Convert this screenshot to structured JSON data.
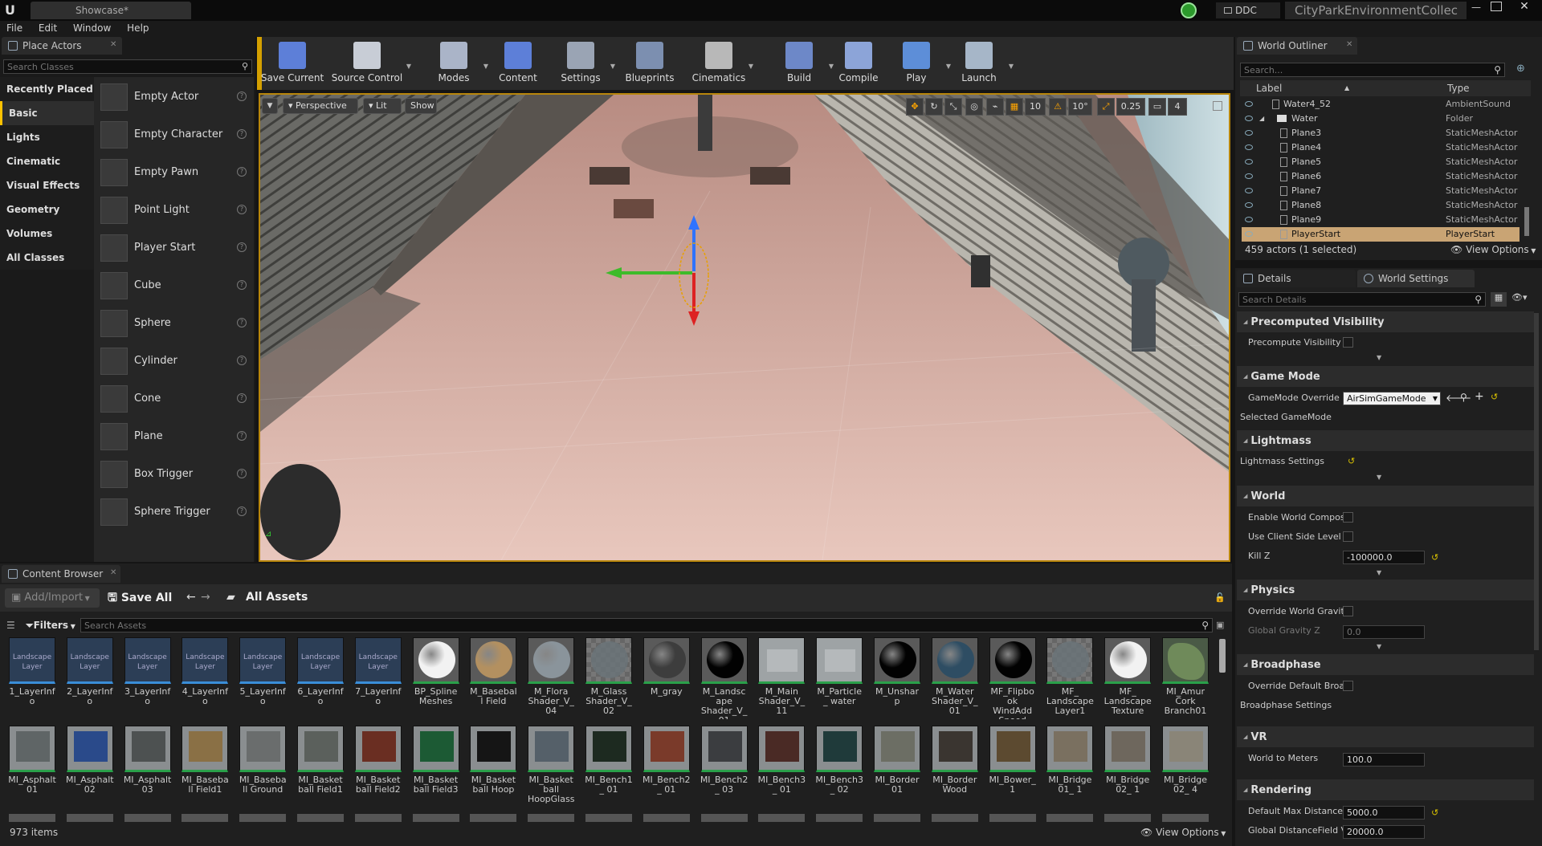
{
  "titlebar": {
    "tab": "Showcase*",
    "ddc": "DDC",
    "project": "CityParkEnvironmentCollec"
  },
  "menu": [
    "File",
    "Edit",
    "Window",
    "Help"
  ],
  "place_actors": {
    "tab": "Place Actors",
    "search_placeholder": "Search Classes",
    "categories": [
      "Recently Placed",
      "Basic",
      "Lights",
      "Cinematic",
      "Visual Effects",
      "Geometry",
      "Volumes",
      "All Classes"
    ],
    "active_category": "Basic",
    "actors": [
      "Empty Actor",
      "Empty Character",
      "Empty Pawn",
      "Point Light",
      "Player Start",
      "Cube",
      "Sphere",
      "Cylinder",
      "Cone",
      "Plane",
      "Box Trigger",
      "Sphere Trigger"
    ]
  },
  "toolbar": [
    {
      "label": "Save Current",
      "icon": "save-icon"
    },
    {
      "label": "Source Control",
      "icon": "source-control-icon"
    },
    {
      "label": "Modes",
      "icon": "modes-icon"
    },
    {
      "label": "Content",
      "icon": "content-icon"
    },
    {
      "label": "Settings",
      "icon": "settings-icon"
    },
    {
      "label": "Blueprints",
      "icon": "blueprints-icon"
    },
    {
      "label": "Cinematics",
      "icon": "cinematics-icon"
    },
    {
      "label": "Build",
      "icon": "build-icon"
    },
    {
      "label": "Compile",
      "icon": "compile-icon"
    },
    {
      "label": "Play",
      "icon": "play-icon"
    },
    {
      "label": "Launch",
      "icon": "launch-icon"
    }
  ],
  "viewport": {
    "perspective": "Perspective",
    "lit": "Lit",
    "show": "Show",
    "grid_snap": "10",
    "rotation_snap": "10°",
    "scale_snap": "0.25",
    "camera_speed": "4"
  },
  "outliner": {
    "tab": "World Outliner",
    "search_placeholder": "Search...",
    "col_label": "Label",
    "col_type": "Type",
    "rows": [
      {
        "name": "Water4_52",
        "type": "AmbientSound"
      },
      {
        "name": "Water",
        "type": "Folder"
      },
      {
        "name": "Plane3",
        "type": "StaticMeshActor"
      },
      {
        "name": "Plane4",
        "type": "StaticMeshActor"
      },
      {
        "name": "Plane5",
        "type": "StaticMeshActor"
      },
      {
        "name": "Plane6",
        "type": "StaticMeshActor"
      },
      {
        "name": "Plane7",
        "type": "StaticMeshActor"
      },
      {
        "name": "Plane8",
        "type": "StaticMeshActor"
      },
      {
        "name": "Plane9",
        "type": "StaticMeshActor"
      },
      {
        "name": "PlayerStart",
        "type": "PlayerStart"
      }
    ],
    "status": "459 actors (1 selected)",
    "view_options": "View Options"
  },
  "details": {
    "tab_details": "Details",
    "tab_world": "World Settings",
    "search_placeholder": "Search Details",
    "sections": {
      "precomputed": "Precomputed Visibility",
      "precompute_visibility": "Precompute Visibility",
      "game_mode": "Game Mode",
      "gamemode_override": "GameMode Override",
      "gamemode_value": "AirSimGameMode",
      "selected_gamemode": "Selected GameMode",
      "lightmass": "Lightmass",
      "lightmass_settings": "Lightmass Settings",
      "world": "World",
      "enable_world_compos": "Enable World Composi",
      "use_client_side": "Use Client Side Level S",
      "kill_z": "Kill Z",
      "kill_z_value": "-100000.0",
      "physics": "Physics",
      "override_gravity": "Override World Gravity",
      "global_gravity": "Global Gravity Z",
      "global_gravity_value": "0.0",
      "broadphase": "Broadphase",
      "override_broad": "Override Default Broac",
      "broadphase_settings": "Broadphase Settings",
      "vr": "VR",
      "world_to_meters": "World to Meters",
      "world_to_meters_value": "100.0",
      "rendering": "Rendering",
      "default_max_distance": "Default Max Distancel",
      "default_max_value": "5000.0",
      "global_distance_field": "Global DistanceField V",
      "global_distance_value": "20000.0"
    }
  },
  "content_browser": {
    "tab": "Content Browser",
    "add_import": "Add/Import",
    "save_all": "Save All",
    "path": "All Assets",
    "filters": "Filters",
    "search_placeholder": "Search Assets",
    "item_count": "973 items",
    "view_options": "View Options",
    "row1": [
      {
        "label": "1_LayerInfo",
        "thumb": "Landscape Layer",
        "kind": "layer"
      },
      {
        "label": "2_LayerInfo",
        "thumb": "Landscape Layer",
        "kind": "layer"
      },
      {
        "label": "3_LayerInfo",
        "thumb": "Landscape Layer",
        "kind": "layer"
      },
      {
        "label": "4_LayerInfo",
        "thumb": "Landscape Layer",
        "kind": "layer"
      },
      {
        "label": "5_LayerInfo",
        "thumb": "Landscape Layer",
        "kind": "layer"
      },
      {
        "label": "6_LayerInfo",
        "thumb": "Landscape Layer",
        "kind": "layer"
      },
      {
        "label": "7_LayerInfo",
        "thumb": "Landscape Layer",
        "kind": "layer"
      },
      {
        "label": "BP_Spline Meshes",
        "thumb": "",
        "kind": "white"
      },
      {
        "label": "M_Baseball Field",
        "thumb": "",
        "kind": "sand"
      },
      {
        "label": "M_Flora Shader_V_04",
        "thumb": "",
        "kind": "gray"
      },
      {
        "label": "M_Glass Shader_V_02",
        "thumb": "",
        "kind": "checker"
      },
      {
        "label": "M_gray",
        "thumb": "",
        "kind": "dark"
      },
      {
        "label": "M_Landscape Shader_V_01",
        "thumb": "",
        "kind": "black"
      },
      {
        "label": "M_Main Shader_V_11",
        "thumb": "",
        "kind": "flat"
      },
      {
        "label": "M_Particle_ water",
        "thumb": "",
        "kind": "flat"
      },
      {
        "label": "M_Unsharp",
        "thumb": "",
        "kind": "black"
      },
      {
        "label": "M_Water Shader_V_01",
        "thumb": "",
        "kind": "blue"
      },
      {
        "label": "MF_Flipbook WindAdd Speed",
        "thumb": "",
        "kind": "black"
      },
      {
        "label": "MF_ Landscape Layer1",
        "thumb": "",
        "kind": "checker"
      },
      {
        "label": "MF_ Landscape Texture",
        "thumb": "",
        "kind": "white"
      },
      {
        "label": "MI_Amur Cork Branch01",
        "thumb": "",
        "kind": "leaf"
      }
    ],
    "row2": [
      {
        "label": "MI_Asphalt01",
        "color": "#5f6566"
      },
      {
        "label": "MI_Asphalt02",
        "color": "#2a4a8a"
      },
      {
        "label": "MI_Asphalt03",
        "color": "#4d5151"
      },
      {
        "label": "MI_Baseball Field1",
        "color": "#8a7045"
      },
      {
        "label": "MI_Baseball Ground",
        "color": "#6a6d6d"
      },
      {
        "label": "MI_Basketball Field1",
        "color": "#5b605c"
      },
      {
        "label": "MI_Basketball Field2",
        "color": "#6a2e22"
      },
      {
        "label": "MI_Basketball Field3",
        "color": "#1c5a34"
      },
      {
        "label": "MI_Basketball Hoop",
        "color": "#151515"
      },
      {
        "label": "MI_Basketball HoopGlass",
        "color": "#556069"
      },
      {
        "label": "MI_Bench1_ 01",
        "color": "#1d2a20"
      },
      {
        "label": "MI_Bench2_ 01",
        "color": "#7a3a2a"
      },
      {
        "label": "MI_Bench2_ 03",
        "color": "#3b3d40"
      },
      {
        "label": "MI_Bench3_ 01",
        "color": "#4a2a25"
      },
      {
        "label": "MI_Bench3_ 02",
        "color": "#1f3a3a"
      },
      {
        "label": "MI_Border01",
        "color": "#6c6e64"
      },
      {
        "label": "MI_Border Wood",
        "color": "#3a3530"
      },
      {
        "label": "MI_Bower_1",
        "color": "#5c4a30"
      },
      {
        "label": "MI_Bridge01_ 1",
        "color": "#7a7060"
      },
      {
        "label": "MI_Bridge02_ 1",
        "color": "#6e675d"
      },
      {
        "label": "MI_Bridge02_ 4",
        "color": "#8a8578"
      }
    ]
  }
}
